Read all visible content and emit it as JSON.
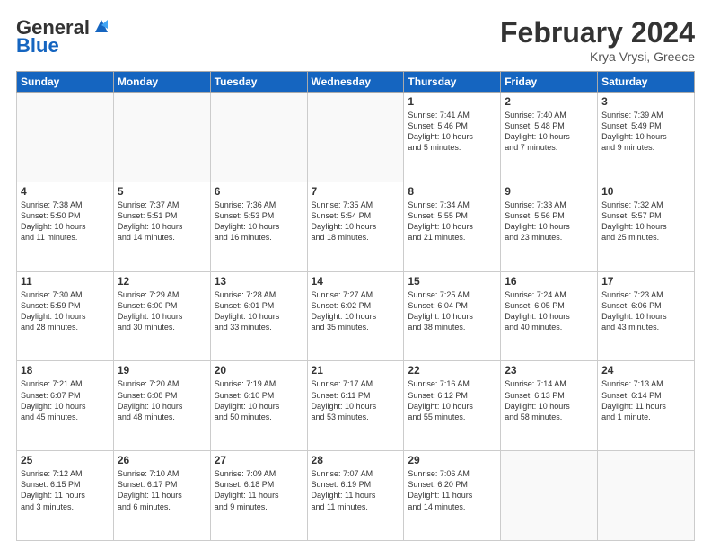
{
  "header": {
    "logo_general": "General",
    "logo_blue": "Blue",
    "month_title": "February 2024",
    "subtitle": "Krya Vrysi, Greece"
  },
  "days_of_week": [
    "Sunday",
    "Monday",
    "Tuesday",
    "Wednesday",
    "Thursday",
    "Friday",
    "Saturday"
  ],
  "weeks": [
    [
      {
        "day": "",
        "info": ""
      },
      {
        "day": "",
        "info": ""
      },
      {
        "day": "",
        "info": ""
      },
      {
        "day": "",
        "info": ""
      },
      {
        "day": "1",
        "info": "Sunrise: 7:41 AM\nSunset: 5:46 PM\nDaylight: 10 hours\nand 5 minutes."
      },
      {
        "day": "2",
        "info": "Sunrise: 7:40 AM\nSunset: 5:48 PM\nDaylight: 10 hours\nand 7 minutes."
      },
      {
        "day": "3",
        "info": "Sunrise: 7:39 AM\nSunset: 5:49 PM\nDaylight: 10 hours\nand 9 minutes."
      }
    ],
    [
      {
        "day": "4",
        "info": "Sunrise: 7:38 AM\nSunset: 5:50 PM\nDaylight: 10 hours\nand 11 minutes."
      },
      {
        "day": "5",
        "info": "Sunrise: 7:37 AM\nSunset: 5:51 PM\nDaylight: 10 hours\nand 14 minutes."
      },
      {
        "day": "6",
        "info": "Sunrise: 7:36 AM\nSunset: 5:53 PM\nDaylight: 10 hours\nand 16 minutes."
      },
      {
        "day": "7",
        "info": "Sunrise: 7:35 AM\nSunset: 5:54 PM\nDaylight: 10 hours\nand 18 minutes."
      },
      {
        "day": "8",
        "info": "Sunrise: 7:34 AM\nSunset: 5:55 PM\nDaylight: 10 hours\nand 21 minutes."
      },
      {
        "day": "9",
        "info": "Sunrise: 7:33 AM\nSunset: 5:56 PM\nDaylight: 10 hours\nand 23 minutes."
      },
      {
        "day": "10",
        "info": "Sunrise: 7:32 AM\nSunset: 5:57 PM\nDaylight: 10 hours\nand 25 minutes."
      }
    ],
    [
      {
        "day": "11",
        "info": "Sunrise: 7:30 AM\nSunset: 5:59 PM\nDaylight: 10 hours\nand 28 minutes."
      },
      {
        "day": "12",
        "info": "Sunrise: 7:29 AM\nSunset: 6:00 PM\nDaylight: 10 hours\nand 30 minutes."
      },
      {
        "day": "13",
        "info": "Sunrise: 7:28 AM\nSunset: 6:01 PM\nDaylight: 10 hours\nand 33 minutes."
      },
      {
        "day": "14",
        "info": "Sunrise: 7:27 AM\nSunset: 6:02 PM\nDaylight: 10 hours\nand 35 minutes."
      },
      {
        "day": "15",
        "info": "Sunrise: 7:25 AM\nSunset: 6:04 PM\nDaylight: 10 hours\nand 38 minutes."
      },
      {
        "day": "16",
        "info": "Sunrise: 7:24 AM\nSunset: 6:05 PM\nDaylight: 10 hours\nand 40 minutes."
      },
      {
        "day": "17",
        "info": "Sunrise: 7:23 AM\nSunset: 6:06 PM\nDaylight: 10 hours\nand 43 minutes."
      }
    ],
    [
      {
        "day": "18",
        "info": "Sunrise: 7:21 AM\nSunset: 6:07 PM\nDaylight: 10 hours\nand 45 minutes."
      },
      {
        "day": "19",
        "info": "Sunrise: 7:20 AM\nSunset: 6:08 PM\nDaylight: 10 hours\nand 48 minutes."
      },
      {
        "day": "20",
        "info": "Sunrise: 7:19 AM\nSunset: 6:10 PM\nDaylight: 10 hours\nand 50 minutes."
      },
      {
        "day": "21",
        "info": "Sunrise: 7:17 AM\nSunset: 6:11 PM\nDaylight: 10 hours\nand 53 minutes."
      },
      {
        "day": "22",
        "info": "Sunrise: 7:16 AM\nSunset: 6:12 PM\nDaylight: 10 hours\nand 55 minutes."
      },
      {
        "day": "23",
        "info": "Sunrise: 7:14 AM\nSunset: 6:13 PM\nDaylight: 10 hours\nand 58 minutes."
      },
      {
        "day": "24",
        "info": "Sunrise: 7:13 AM\nSunset: 6:14 PM\nDaylight: 11 hours\nand 1 minute."
      }
    ],
    [
      {
        "day": "25",
        "info": "Sunrise: 7:12 AM\nSunset: 6:15 PM\nDaylight: 11 hours\nand 3 minutes."
      },
      {
        "day": "26",
        "info": "Sunrise: 7:10 AM\nSunset: 6:17 PM\nDaylight: 11 hours\nand 6 minutes."
      },
      {
        "day": "27",
        "info": "Sunrise: 7:09 AM\nSunset: 6:18 PM\nDaylight: 11 hours\nand 9 minutes."
      },
      {
        "day": "28",
        "info": "Sunrise: 7:07 AM\nSunset: 6:19 PM\nDaylight: 11 hours\nand 11 minutes."
      },
      {
        "day": "29",
        "info": "Sunrise: 7:06 AM\nSunset: 6:20 PM\nDaylight: 11 hours\nand 14 minutes."
      },
      {
        "day": "",
        "info": ""
      },
      {
        "day": "",
        "info": ""
      }
    ]
  ]
}
